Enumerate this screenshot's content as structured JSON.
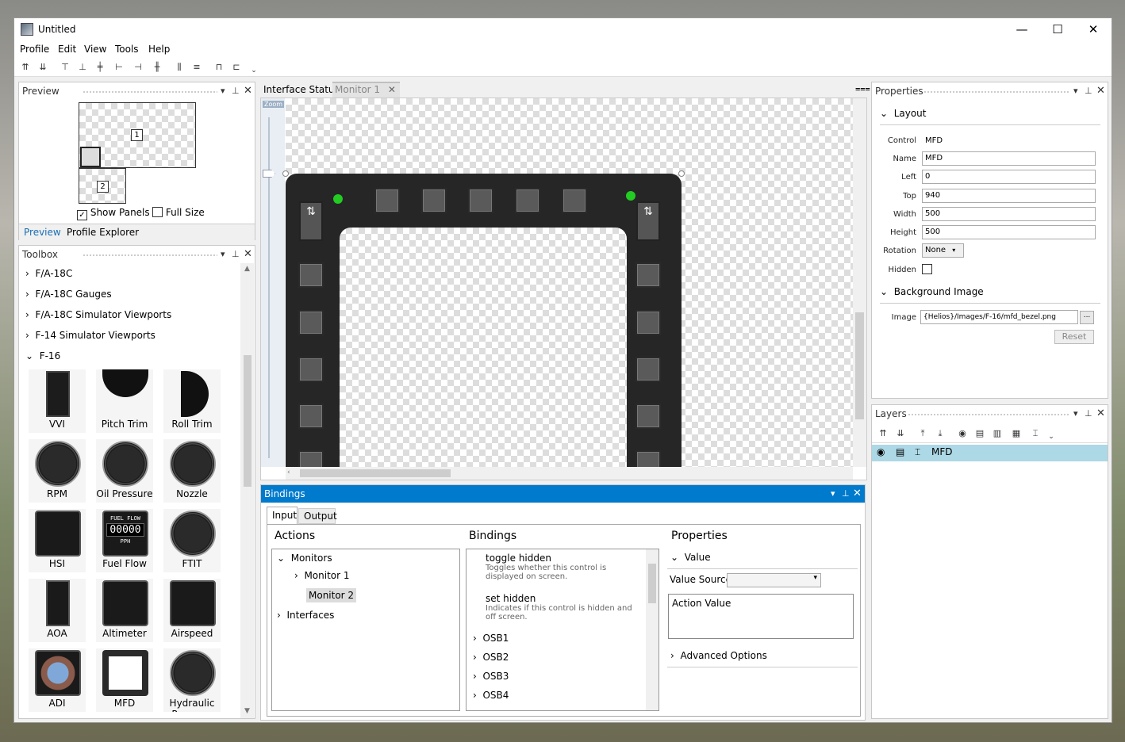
{
  "window": {
    "title": "Untitled",
    "minimize": "—",
    "maximize": "☐",
    "close": "✕"
  },
  "menu": {
    "profile": "Profile",
    "edit": "Edit",
    "view": "View",
    "tools": "Tools",
    "help": "Help"
  },
  "preview": {
    "title": "Preview",
    "monitor1": "1",
    "monitor2": "2",
    "show_panels_label": "Show Panels",
    "show_panels_checked": true,
    "full_size_label": "Full Size",
    "full_size_checked": false,
    "tabs": [
      "Preview",
      "Profile Explorer"
    ]
  },
  "toolbox": {
    "title": "Toolbox",
    "categories": [
      "F/A-18C",
      "F/A-18C Gauges",
      "F/A-18C Simulator Viewports",
      "F-14 Simulator Viewports",
      "F-16"
    ],
    "tools": [
      "VVI",
      "Pitch Trim",
      "Roll Trim",
      "RPM",
      "Oil Pressure",
      "Nozzle",
      "HSI",
      "Fuel Flow",
      "FTIT",
      "AOA",
      "Altimeter",
      "Airspeed",
      "ADI",
      "MFD",
      "Hydraulic Pressure"
    ],
    "fuel_flow_top": "FUEL   FLOW",
    "fuel_flow_value": "00000",
    "fuel_flow_unit": "PPH"
  },
  "editor": {
    "tabs": [
      "Interface Status",
      "Monitor 1"
    ],
    "zoom_label": "Zoom"
  },
  "properties": {
    "title": "Properties",
    "layout_section": "Layout",
    "control_label": "Control",
    "control_value": "MFD",
    "name_label": "Name",
    "name_value": "MFD",
    "left_label": "Left",
    "left_value": "0",
    "top_label": "Top",
    "top_value": "940",
    "width_label": "Width",
    "width_value": "500",
    "height_label": "Height",
    "height_value": "500",
    "rotation_label": "Rotation",
    "rotation_value": "None",
    "hidden_label": "Hidden",
    "background_section": "Background Image",
    "image_label": "Image",
    "image_value": "{Helios}/Images/F-16/mfd_bezel.png",
    "browse_label": "...",
    "reset_label": "Reset"
  },
  "layers": {
    "title": "Layers",
    "item": "MFD"
  },
  "bindings": {
    "title": "Bindings",
    "tabs": [
      "Input",
      "Output"
    ],
    "actions_header": "Actions",
    "bindings_header": "Bindings",
    "properties_header": "Properties",
    "tree": {
      "monitors": "Monitors",
      "monitor1": "Monitor 1",
      "monitor2": "Monitor 2",
      "interfaces": "Interfaces"
    },
    "items": [
      {
        "title": "toggle hidden",
        "desc": "Toggles whether this control is displayed on screen."
      },
      {
        "title": "set hidden",
        "desc": "Indicates if this control is hidden and off screen."
      }
    ],
    "osb": [
      "OSB1",
      "OSB2",
      "OSB3",
      "OSB4"
    ],
    "value_section": "Value",
    "value_source_label": "Value Source",
    "action_value_label": "Action Value",
    "advanced_label": "Advanced Options"
  },
  "colors": {
    "accent": "#007acc",
    "selection": "#add8e6",
    "led": "#22cc22"
  }
}
